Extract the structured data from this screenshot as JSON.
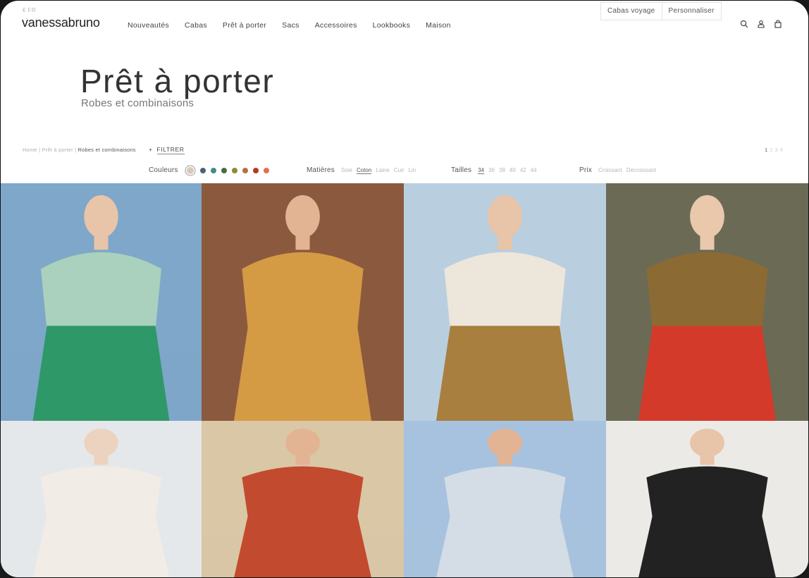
{
  "header": {
    "locale": "€ FR",
    "logo": "vanessabruno",
    "nav": [
      "Nouveautés",
      "Cabas",
      "Prêt à porter",
      "Sacs",
      "Accessoires",
      "Lookbooks",
      "Maison"
    ],
    "top_buttons": [
      "Cabas voyage",
      "Personnaliser"
    ],
    "icons": [
      "search-icon",
      "account-icon",
      "bag-icon"
    ]
  },
  "hero": {
    "title": "Prêt à porter",
    "subtitle": "Robes et combinaisons"
  },
  "breadcrumb": {
    "items": [
      "Home",
      "Prêt à porter"
    ],
    "current": "Robes et combinaisons",
    "separator": " | "
  },
  "filter_toggle": {
    "prefix": "+",
    "label": "FILTRER"
  },
  "pagination": {
    "pages": [
      "1",
      "2",
      "3",
      "4"
    ],
    "current": "1"
  },
  "filters": {
    "colors": {
      "label": "Couleurs",
      "swatches": [
        "#d9c9b8",
        "#4a6279",
        "#3f8c8a",
        "#496b46",
        "#8f8a35",
        "#b0733e",
        "#b23a28",
        "#e36f4c"
      ]
    },
    "materials": {
      "label": "Matières",
      "options": [
        "Soie",
        "Coton",
        "Laine",
        "Cuir",
        "Lin"
      ],
      "selected": "Coton"
    },
    "sizes": {
      "label": "Tailles",
      "options": [
        "34",
        "36",
        "38",
        "40",
        "42",
        "44"
      ],
      "selected": "34"
    },
    "price": {
      "label": "Prix",
      "options": [
        "Croissant",
        "Décroissant"
      ]
    }
  },
  "products": [
    {
      "name": "product-photo-green-dress",
      "colors": {
        "bg": "#7ea7c9",
        "main": "#2f9868",
        "top": "#a9d1bd",
        "skin": "#e8c4a8"
      }
    },
    {
      "name": "product-photo-floral-dress",
      "colors": {
        "bg": "#8b5a3e",
        "main": "#d59a44",
        "top": "#d59a44",
        "skin": "#e2b494"
      }
    },
    {
      "name": "product-photo-striped-shirt",
      "colors": {
        "bg": "#b9cfe0",
        "main": "#a87f3f",
        "top": "#ede6da",
        "skin": "#e8c4a8"
      }
    },
    {
      "name": "product-photo-khaki-jacket",
      "colors": {
        "bg": "#6b6a55",
        "main": "#d33a2a",
        "top": "#8c6a34",
        "skin": "#e9c8ab"
      }
    },
    {
      "name": "product-photo-white-blouse",
      "colors": {
        "bg": "#e5e8ea",
        "main": "#f1ece6",
        "top": "#f1ece6",
        "skin": "#ecd3bf"
      }
    },
    {
      "name": "product-photo-rust-knit",
      "colors": {
        "bg": "#d9c7a6",
        "main": "#c24a2e",
        "top": "#c24a2e",
        "skin": "#e2b494"
      }
    },
    {
      "name": "product-photo-white-dress-sea",
      "colors": {
        "bg": "#a7c2de",
        "main": "#d4dce6",
        "top": "#d4dce6",
        "skin": "#e2b494"
      }
    },
    {
      "name": "product-photo-black-dress",
      "colors": {
        "bg": "#ebeae6",
        "main": "#222222",
        "top": "#222222",
        "skin": "#e8c4a8"
      }
    }
  ]
}
